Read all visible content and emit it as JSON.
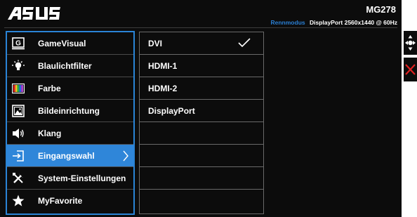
{
  "header": {
    "brand": "ASUS",
    "model": "MG278",
    "mode_label": "Rennmodus",
    "input_info": "DisplayPort 2560x1440 @ 60Hz"
  },
  "main_menu": {
    "items": [
      {
        "label": "GameVisual",
        "icon": "gamevisual-icon"
      },
      {
        "label": "Blaulichtfilter",
        "icon": "bulb-icon"
      },
      {
        "label": "Farbe",
        "icon": "color-bars-icon"
      },
      {
        "label": "Bildeinrichtung",
        "icon": "image-icon"
      },
      {
        "label": "Klang",
        "icon": "speaker-icon"
      },
      {
        "label": "Eingangswahl",
        "icon": "input-select-icon",
        "selected": true
      },
      {
        "label": "System-Einstellungen",
        "icon": "tools-icon"
      },
      {
        "label": "MyFavorite",
        "icon": "star-icon"
      }
    ]
  },
  "sub_menu": {
    "items": [
      "DVI",
      "HDMI-1",
      "HDMI-2",
      "DisplayPort",
      "",
      "",
      "",
      ""
    ],
    "checked_index": 0
  },
  "side_buttons": {
    "nav": "navigation-joystick-icon",
    "close": "close-icon"
  },
  "colors": {
    "background": "#0c0c0c",
    "accent_blue": "#2f86d9",
    "close_red": "#e02020"
  }
}
